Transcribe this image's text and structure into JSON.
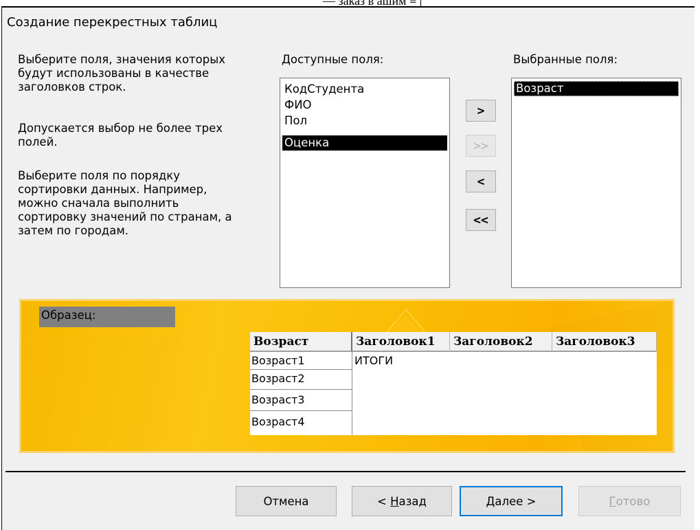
{
  "window": {
    "title": "Создание перекрестных таблиц"
  },
  "top_fragment": "— заказ в ашим ≡",
  "instructions": {
    "p1": [
      "Выберите поля, значения которых",
      "будут использованы в качестве",
      "заголовков строк."
    ],
    "p2": [
      "Допускается выбор не более трех",
      "полей."
    ],
    "p3": [
      "Выберите поля по порядку",
      "сортировки данных.  Например,",
      "можно сначала выполнить",
      "сортировку значений по странам, а",
      "затем по городам."
    ]
  },
  "available": {
    "label": "Доступные поля:",
    "items": [
      "КодСтудента",
      "ФИО",
      "Пол",
      "Оценка"
    ],
    "selected_index": 3
  },
  "selected": {
    "label": "Выбранные поля:",
    "items": [
      "Возраст"
    ],
    "selected_index": 0
  },
  "move_buttons": {
    "add": ">",
    "add_all": ">>",
    "remove": "<",
    "remove_all": "<<"
  },
  "sample": {
    "label": "Образец:",
    "headers": [
      "Возраст",
      "Заголовок1",
      "Заголовок2",
      "Заголовок3"
    ],
    "rows": [
      "Возраст1",
      "Возраст2",
      "Возраст3",
      "Возраст4"
    ],
    "totals_label": "ИТОГИ"
  },
  "buttons": {
    "cancel": "Отмена",
    "back_prefix": "< ",
    "back_accel": "Н",
    "back_rest": "азад",
    "next_accel": "Д",
    "next_rest": "алее >",
    "finish_accel": "Г",
    "finish_rest": "отово"
  }
}
